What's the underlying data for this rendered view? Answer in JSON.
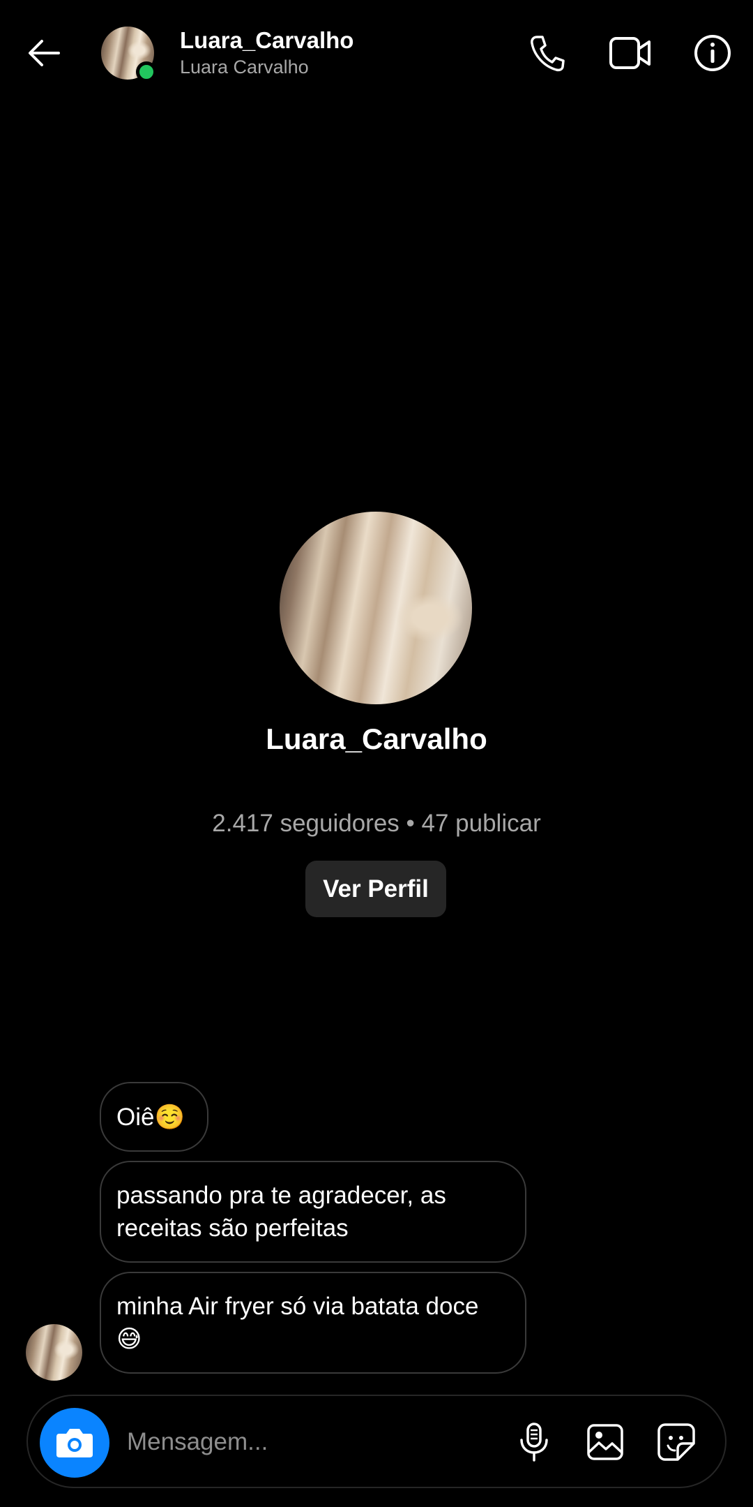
{
  "header": {
    "username": "Luara_Carvalho",
    "name": "Luara Carvalho",
    "online": true,
    "icons": [
      "back-arrow-icon",
      "phone-icon",
      "video-camera-icon",
      "info-icon"
    ]
  },
  "profile": {
    "username": "Luara_Carvalho",
    "stats": "2.417 seguidores • 47 publicar",
    "view_profile_label": "Ver Perfil"
  },
  "messages": [
    {
      "text": "Oiê☺️"
    },
    {
      "text": "passando pra te agradecer, as receitas são perfeitas"
    },
    {
      "text": "minha Air fryer só via batata doce 😅"
    }
  ],
  "composer": {
    "placeholder": "Mensagem...",
    "icons": [
      "camera-icon",
      "microphone-icon",
      "gallery-icon",
      "sticker-icon"
    ]
  },
  "colors": {
    "background": "#000000",
    "accent": "#0a84ff",
    "online": "#22c55e",
    "secondary_text": "#a8a8a8",
    "button_bg": "#262626"
  }
}
